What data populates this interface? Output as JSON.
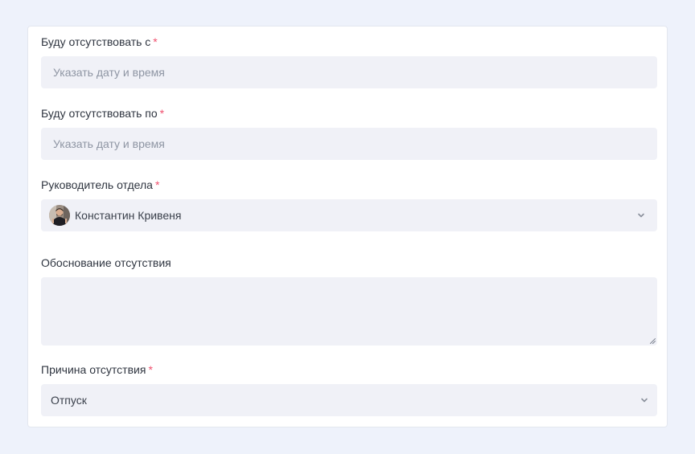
{
  "form": {
    "absent_from": {
      "label": "Буду отсутствовать с",
      "required_mark": "*",
      "placeholder": "Указать дату и время"
    },
    "absent_to": {
      "label": "Буду отсутствовать по",
      "required_mark": "*",
      "placeholder": "Указать дату и время"
    },
    "manager": {
      "label": "Руководитель отдела",
      "required_mark": "*",
      "value": "Константин Кривеня",
      "icon": "chevron-down-icon"
    },
    "justification": {
      "label": "Обоснование отсутствия",
      "value": ""
    },
    "reason": {
      "label": "Причина отсутствия",
      "required_mark": "*",
      "value": "Отпуск",
      "icon": "chevron-down-icon"
    }
  },
  "colors": {
    "page_bg": "#eef2fb",
    "field_bg": "#f0f1f7",
    "required": "#f0506e",
    "label_text": "#2f3540",
    "placeholder_text": "#8e95a3"
  }
}
